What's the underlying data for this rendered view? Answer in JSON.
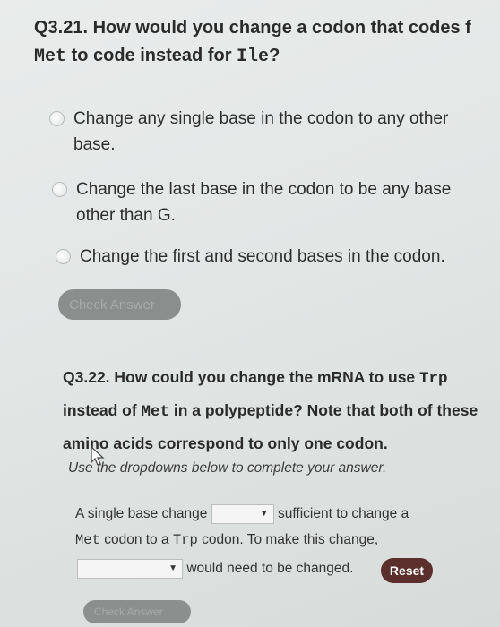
{
  "q1": {
    "title_prefix": "Q3.21. How would you change a codon that codes f",
    "title_code1": "Met",
    "title_mid": " to code instead for ",
    "title_code2": "Ile",
    "title_end": "?",
    "options": [
      {
        "line1": "Change any single base in the codon to any other",
        "line2": "base."
      },
      {
        "line1": "Change the last base in the codon to be any base",
        "line2": "other than G."
      },
      {
        "line1": "Change the first and second bases in the codon.",
        "line2": ""
      }
    ],
    "check_answer_label": "Check Answer"
  },
  "q2": {
    "title_a": "Q3.22. How could you change the mRNA to use ",
    "title_code1": "Trp",
    "title_b": " instead of ",
    "title_code2": "Met",
    "title_c": " in a polypeptide? Note that both of these amino acids correspond to only one codon.",
    "instructions": "Use the dropdowns below to complete your answer.",
    "line1_before": "A single base change",
    "line1_after": "sufficient to change a",
    "line2_code1": "Met",
    "line2_mid": " codon to a ",
    "line2_code2": "Trp",
    "line2_end": " codon. To make this change,",
    "line3_after": "would need to be changed.",
    "dropdown1_value": "",
    "dropdown2_value": "",
    "reset_label": "Reset",
    "check_answer_label": "Check Answer"
  },
  "icons": {
    "cursor": "mouse-pointer-icon",
    "dropdown_arrow": "triangle-down-icon"
  },
  "colors": {
    "reset_button": "#5b2f2c",
    "disabled_button": "#8a8f8d"
  }
}
